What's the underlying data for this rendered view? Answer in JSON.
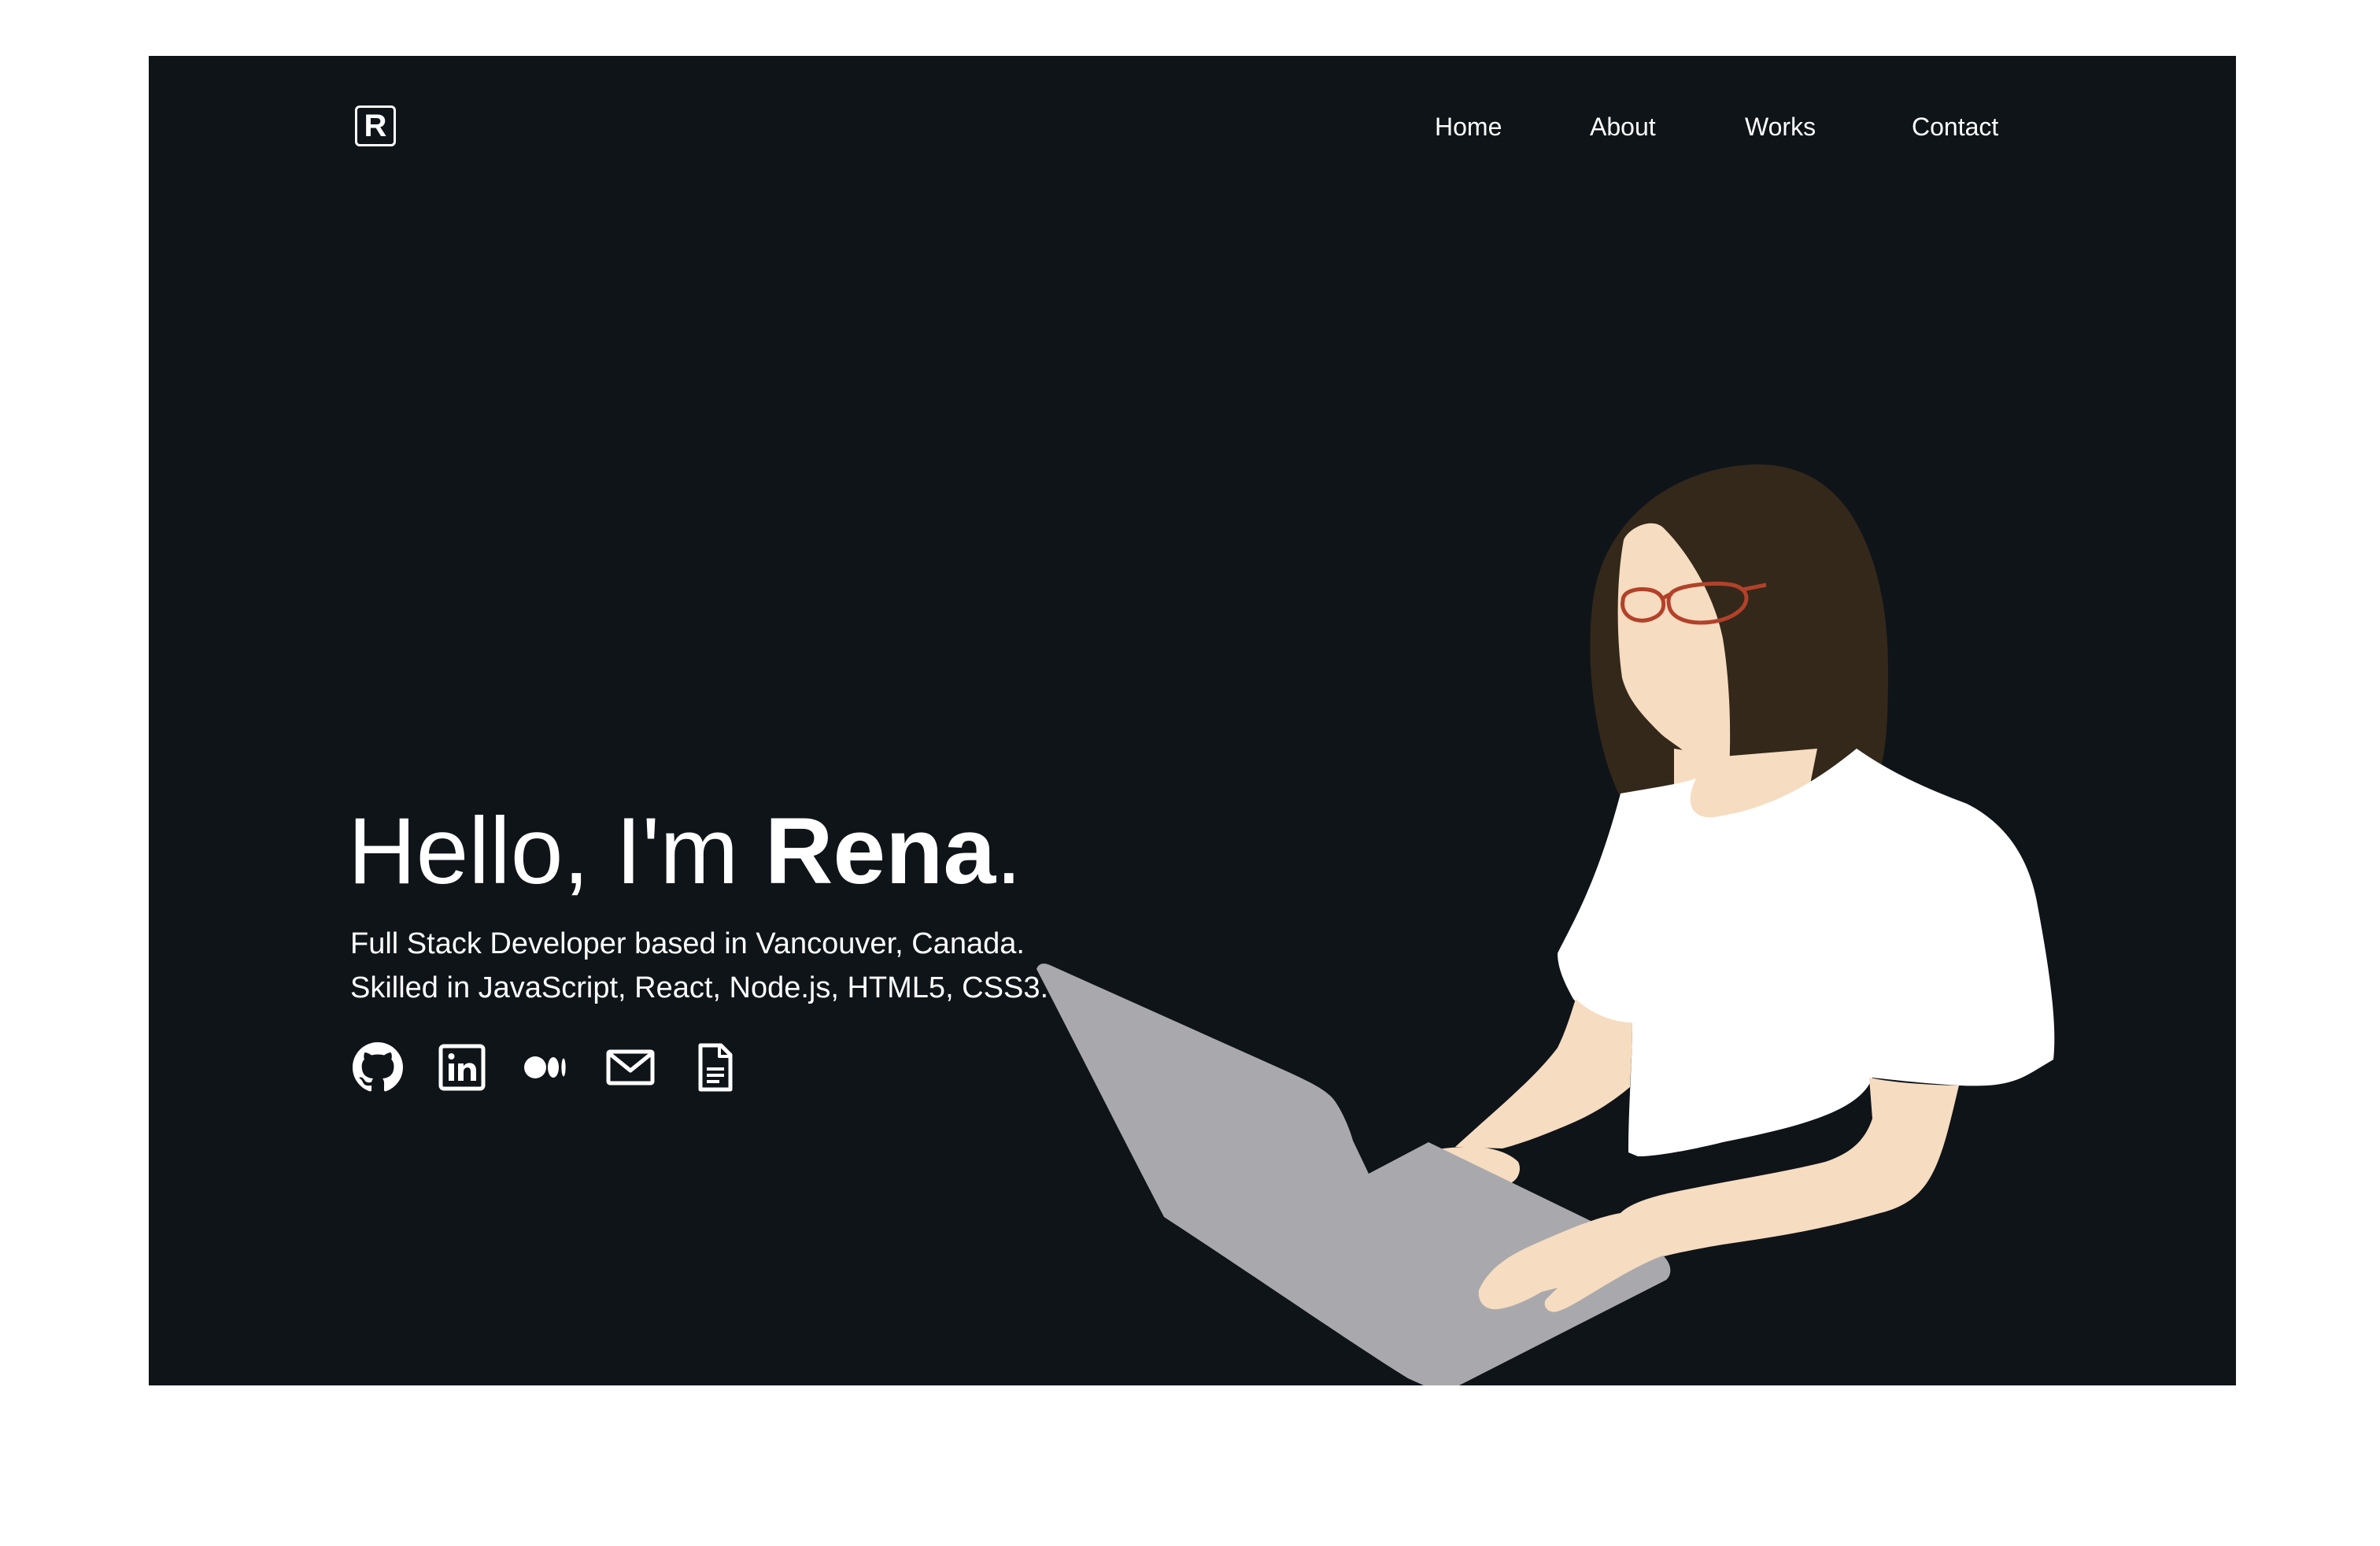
{
  "brand": {
    "logo_letter": "R"
  },
  "nav": [
    {
      "label": "Home"
    },
    {
      "label": "About"
    },
    {
      "label": "Works"
    },
    {
      "label": "Contact"
    }
  ],
  "hero": {
    "greeting": "Hello, I'm ",
    "name": "Rena",
    "punctuation": ".",
    "line1": "Full Stack Developer based in Vancouver, Canada.",
    "line2": "Skilled in JavaScript, React, Node.js, HTML5, CSS3."
  },
  "social_icons": [
    "github-icon",
    "linkedin-icon",
    "medium-icon",
    "email-icon",
    "document-icon"
  ],
  "colors": {
    "background": "#0f1419",
    "text": "#ffffff",
    "skin": "#f6dcc0",
    "hair": "#33281a",
    "shirt": "#ffffff",
    "laptop": "#a9a9ad",
    "glasses": "#b3412a"
  }
}
